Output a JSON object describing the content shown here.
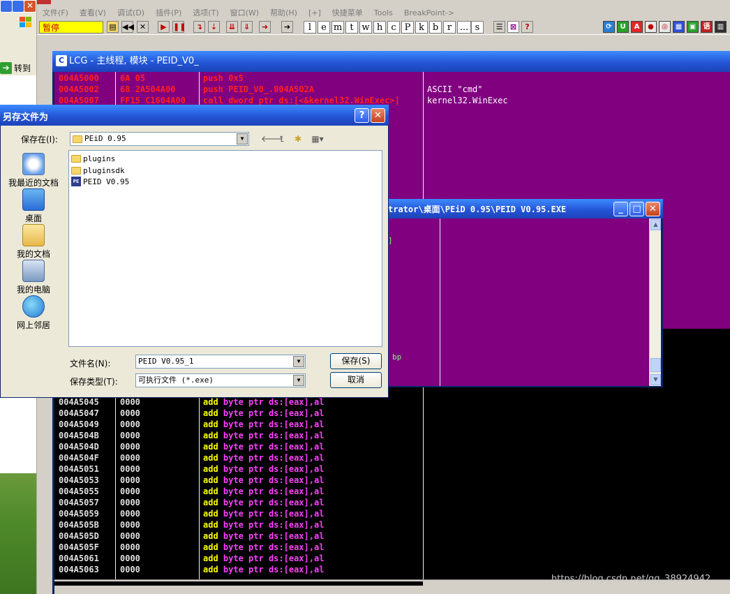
{
  "left_window": {
    "goto_label": "转到"
  },
  "olly": {
    "menu": [
      "文件(F)",
      "查看(V)",
      "调试(D)",
      "插件(P)",
      "选项(T)",
      "窗口(W)",
      "帮助(H)",
      "[+]",
      "快捷菜单",
      "Tools",
      "BreakPoint->"
    ],
    "status": "暂停",
    "letter_buttons": [
      "l",
      "e",
      "m",
      "t",
      "w",
      "h",
      "c",
      "P",
      "k",
      "b",
      "r",
      "...",
      "s"
    ]
  },
  "cpu_window": {
    "title": "LCG -  主线程, 模块 - PEID_V0_",
    "top_rows": [
      {
        "addr": "004A5000",
        "hex": "6A 05",
        "asm": "push 0x5"
      },
      {
        "addr": "004A5002",
        "hex": "68 2A504A00",
        "asm": "push PEID_V0_.004A502A"
      },
      {
        "addr": "004A5007",
        "hex": "FF15 C1604A00",
        "asm": "call dword ptr ds:[<&kernel32.WinExec>]"
      }
    ],
    "comments": [
      "ASCII \"cmd\"",
      "kernel32.WinExec"
    ],
    "bp_label": "bp",
    "bottom_rows": [
      {
        "addr": "004A5045",
        "hex": "0000"
      },
      {
        "addr": "004A5047",
        "hex": "0000"
      },
      {
        "addr": "004A5049",
        "hex": "0000"
      },
      {
        "addr": "004A504B",
        "hex": "0000"
      },
      {
        "addr": "004A504D",
        "hex": "0000"
      },
      {
        "addr": "004A504F",
        "hex": "0000"
      },
      {
        "addr": "004A5051",
        "hex": "0000"
      },
      {
        "addr": "004A5053",
        "hex": "0000"
      },
      {
        "addr": "004A5055",
        "hex": "0000"
      },
      {
        "addr": "004A5057",
        "hex": "0000"
      },
      {
        "addr": "004A5059",
        "hex": "0000"
      },
      {
        "addr": "004A505B",
        "hex": "0000"
      },
      {
        "addr": "004A505D",
        "hex": "0000"
      },
      {
        "addr": "004A505F",
        "hex": "0000"
      },
      {
        "addr": "004A5061",
        "hex": "0000"
      },
      {
        "addr": "004A5063",
        "hex": "0000"
      }
    ],
    "asm_kw": "add",
    "asm_op": "byte ptr ds:[eax],al"
  },
  "file_window": {
    "title": "trator\\桌面\\PEiD 0.95\\PEID V0.95.EXE"
  },
  "save_dialog": {
    "title": "另存文件为",
    "save_in_label": "保存在(I):",
    "save_in_value": "PEiD 0.95",
    "places": [
      "我最近的文档",
      "桌面",
      "我的文档",
      "我的电脑",
      "网上邻居"
    ],
    "files": [
      {
        "name": "plugins",
        "type": "folder"
      },
      {
        "name": "pluginsdk",
        "type": "folder"
      },
      {
        "name": "PEID V0.95",
        "type": "exe"
      }
    ],
    "filename_label": "文件名(N):",
    "filename_value": "PEID V0.95_1",
    "filetype_label": "保存类型(T):",
    "filetype_value": "可执行文件 (*.exe)",
    "save_button": "保存(S)",
    "cancel_button": "取消"
  },
  "watermark": "https://blog.csdn.net/qq_38924942"
}
